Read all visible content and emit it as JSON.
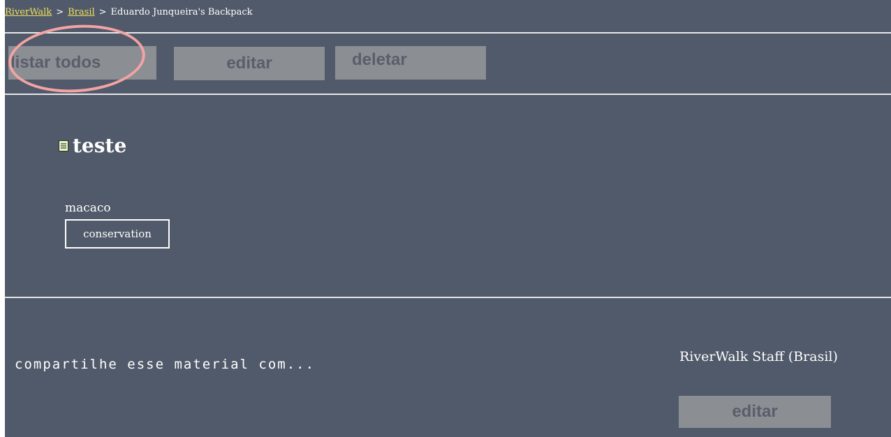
{
  "breadcrumb": {
    "root": "RiverWalk",
    "section": "Brasil",
    "current": "Eduardo Junqueira's Backpack",
    "separator": ">"
  },
  "toolbar": {
    "list_all_label": "listar todos",
    "edit_label": "editar",
    "delete_label": "deletar"
  },
  "item": {
    "title": "teste",
    "name": "macaco",
    "tag": "conservation"
  },
  "share": {
    "label": "compartilhe esse material com...",
    "group": "RiverWalk Staff (Brasil)",
    "edit_label": "editar"
  },
  "colors": {
    "background": "#515a6a",
    "button": "#8b8e93",
    "button_text": "#595e6a",
    "link": "#f2df5c",
    "annotation_circle": "#f3a3a3"
  },
  "icons": {
    "document": "document-icon"
  }
}
